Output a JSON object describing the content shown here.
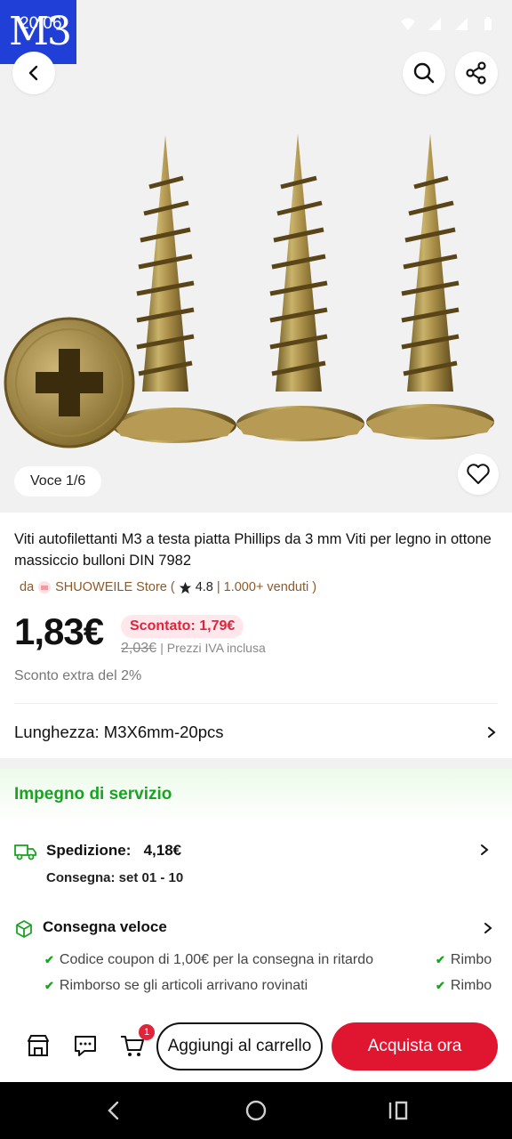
{
  "status_bar": {
    "time": "20:06",
    "overlay_badge": "M3"
  },
  "gallery": {
    "counter": "Voce 1/6"
  },
  "product": {
    "title": "Viti autofilettanti M3 a testa piatta Phillips da 3 mm Viti per legno in ottone massiccio bulloni DIN 7982",
    "store_prefix": "da",
    "store_name": "SHUOWEILE Store",
    "open_paren": "(",
    "rating": "4.8",
    "sold": "| 1.000+ venduti )",
    "price": "1,83€",
    "discount_badge": "Scontato: 1,79€",
    "old_price": "2,03€",
    "vat_note": "| Prezzi IVA inclusa",
    "extra_discount": "Sconto extra del 2%",
    "variant_label": "Lunghezza: M3X6mm-20pcs"
  },
  "service": {
    "title": "Impegno di servizio",
    "shipping_label": "Spedizione:",
    "shipping_price": "4,18€",
    "delivery": "Consegna: set 01 - 10",
    "fast_delivery": "Consegna veloce",
    "perks": [
      "Codice coupon di 1,00€ per la consegna in ritardo",
      "Rimborso se gli articoli arrivano rovinati"
    ],
    "perks_right": [
      "Rimbo",
      "Rimbo"
    ]
  },
  "action_bar": {
    "cart_count": "1",
    "add_to_cart": "Aggiungi al carrello",
    "buy_now": "Acquista ora"
  },
  "colors": {
    "accent_red": "#e0152f",
    "service_green": "#1aa322",
    "store_brown": "#8a5a2b"
  }
}
